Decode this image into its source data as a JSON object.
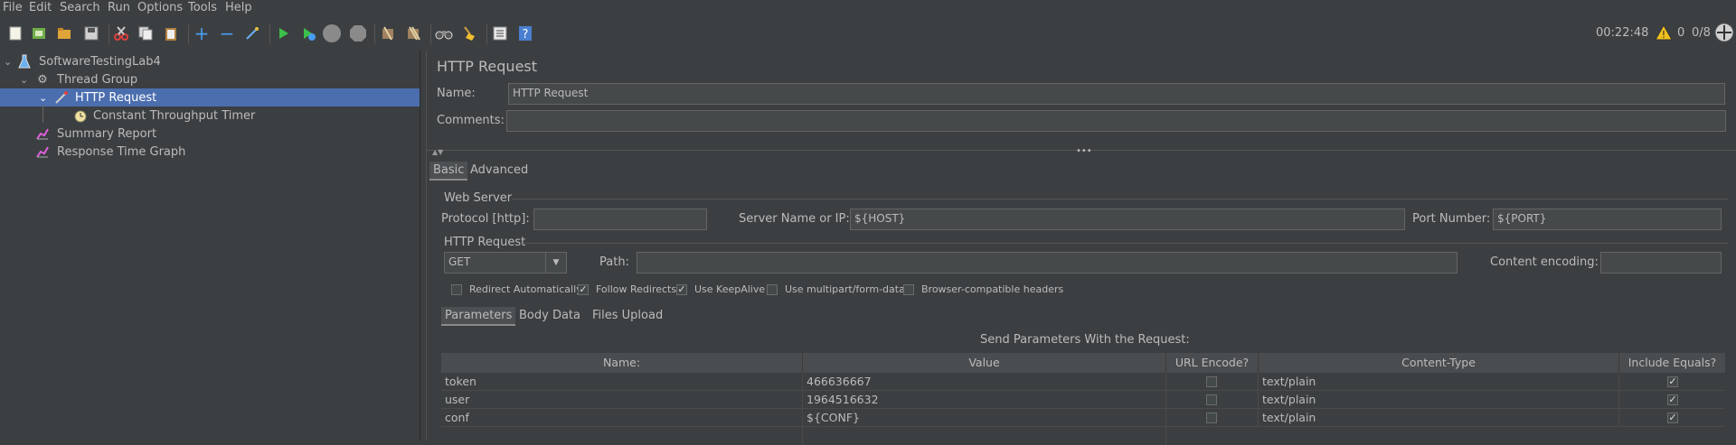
{
  "menu": [
    "File",
    "Edit",
    "Search",
    "Run",
    "Options",
    "Tools",
    "Help"
  ],
  "status": {
    "time": "00:22:48",
    "warnings": "0",
    "threads": "0/8"
  },
  "tree": [
    {
      "label": "SoftwareTestingLab4",
      "icon": "flask-icon"
    },
    {
      "label": "Thread Group",
      "icon": "gear-icon"
    },
    {
      "label": "HTTP Request",
      "icon": "pipette-icon"
    },
    {
      "label": "Constant Throughput Timer",
      "icon": "timer-icon"
    },
    {
      "label": "Summary Report",
      "icon": "graph-icon"
    },
    {
      "label": "Response Time Graph",
      "icon": "graph-icon"
    }
  ],
  "panel": {
    "title": "HTTP Request",
    "name_label": "Name:",
    "name_value": "HTTP Request",
    "comments_label": "Comments:",
    "comments_value": "",
    "tabs": [
      "Basic",
      "Advanced"
    ],
    "web_server": "Web Server",
    "protocol_label": "Protocol [http]:",
    "protocol_value": "",
    "server_label": "Server Name or IP:",
    "server_value": "${HOST}",
    "port_label": "Port Number:",
    "port_value": "${PORT}",
    "http_request": "HTTP Request",
    "method": "GET",
    "path_label": "Path:",
    "path_value": "",
    "encoding_label": "Content encoding:",
    "encoding_value": "",
    "checkboxes": [
      {
        "label": "Redirect Automatically",
        "checked": false
      },
      {
        "label": "Follow Redirects",
        "checked": true
      },
      {
        "label": "Use KeepAlive",
        "checked": true
      },
      {
        "label": "Use multipart/form-data",
        "checked": false
      },
      {
        "label": "Browser-compatible headers",
        "checked": false
      }
    ],
    "subtabs": [
      "Parameters",
      "Body Data",
      "Files Upload"
    ],
    "send_params": "Send Parameters With the Request:",
    "columns": [
      "Name:",
      "Value",
      "URL Encode?",
      "Content-Type",
      "Include Equals?"
    ],
    "rows": [
      {
        "name": "token",
        "value": "466636667",
        "url_encode": false,
        "content_type": "text/plain",
        "include_equals": true
      },
      {
        "name": "user",
        "value": "1964516632",
        "url_encode": false,
        "content_type": "text/plain",
        "include_equals": true
      },
      {
        "name": "conf",
        "value": "${CONF}",
        "url_encode": false,
        "content_type": "text/plain",
        "include_equals": true
      }
    ]
  }
}
